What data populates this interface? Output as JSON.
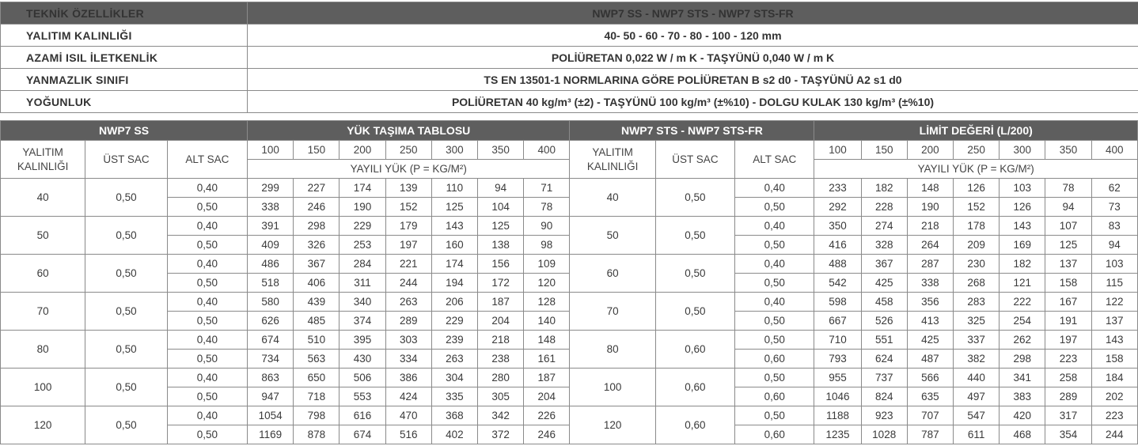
{
  "spec": {
    "header": [
      "TEKNİK ÖZELLİKLER",
      "NWP7 SS - NWP7 STS - NWP7 STS-FR"
    ],
    "rows": [
      {
        "label": "YALITIM KALINLIĞI",
        "value": "40- 50 - 60 - 70 - 80 - 100 - 120 mm"
      },
      {
        "label": "AZAMİ ISIL İLETKENLİK",
        "value": "POLİÜRETAN 0,022 W / m K - TAŞYÜNÜ 0,040 W / m K"
      },
      {
        "label": "YANMAZLIK SINIFI",
        "value": "TS EN 13501-1 NORMLARINA GÖRE POLİÜRETAN B s2 d0 - TAŞYÜNÜ A2 s1 d0"
      },
      {
        "label": "YOĞUNLUK",
        "value": "POLİÜRETAN 40 kg/m³ (±2) - TAŞYÜNÜ 100 kg/m³ (±%10) - DOLGU KULAK 130 kg/m³ (±%10)"
      }
    ]
  },
  "load": {
    "left_title": "NWP7 SS",
    "left_table_title": "YÜK TAŞIMA TABLOSU",
    "right_title": "NWP7 STS - NWP7 STS-FR",
    "right_table_title": "LİMİT DEĞERİ (L/200)",
    "col_thickness": "YALITIM KALINLIĞI",
    "col_top": "ÜST SAC",
    "col_bottom": "ALT SAC",
    "spans": [
      "100",
      "150",
      "200",
      "250",
      "300",
      "350",
      "400"
    ],
    "load_label": "YAYILI YÜK (P = KG/M²)",
    "left_groups": [
      {
        "thickness": "40",
        "top": "0,50",
        "rows": [
          {
            "bottom": "0,40",
            "values": [
              "299",
              "227",
              "174",
              "139",
              "110",
              "94",
              "71"
            ]
          },
          {
            "bottom": "0,50",
            "values": [
              "338",
              "246",
              "190",
              "152",
              "125",
              "104",
              "78"
            ]
          }
        ]
      },
      {
        "thickness": "50",
        "top": "0,50",
        "rows": [
          {
            "bottom": "0,40",
            "values": [
              "391",
              "298",
              "229",
              "179",
              "143",
              "125",
              "90"
            ]
          },
          {
            "bottom": "0,50",
            "values": [
              "409",
              "326",
              "253",
              "197",
              "160",
              "138",
              "98"
            ]
          }
        ]
      },
      {
        "thickness": "60",
        "top": "0,50",
        "rows": [
          {
            "bottom": "0,40",
            "values": [
              "486",
              "367",
              "284",
              "221",
              "174",
              "156",
              "109"
            ]
          },
          {
            "bottom": "0,50",
            "values": [
              "518",
              "406",
              "311",
              "244",
              "194",
              "172",
              "120"
            ]
          }
        ]
      },
      {
        "thickness": "70",
        "top": "0,50",
        "rows": [
          {
            "bottom": "0,40",
            "values": [
              "580",
              "439",
              "340",
              "263",
              "206",
              "187",
              "128"
            ]
          },
          {
            "bottom": "0,50",
            "values": [
              "626",
              "485",
              "374",
              "289",
              "229",
              "204",
              "140"
            ]
          }
        ]
      },
      {
        "thickness": "80",
        "top": "0,50",
        "rows": [
          {
            "bottom": "0,40",
            "values": [
              "674",
              "510",
              "395",
              "303",
              "239",
              "218",
              "148"
            ]
          },
          {
            "bottom": "0,50",
            "values": [
              "734",
              "563",
              "430",
              "334",
              "263",
              "238",
              "161"
            ]
          }
        ]
      },
      {
        "thickness": "100",
        "top": "0,50",
        "rows": [
          {
            "bottom": "0,40",
            "values": [
              "863",
              "650",
              "506",
              "386",
              "304",
              "280",
              "187"
            ]
          },
          {
            "bottom": "0,50",
            "values": [
              "947",
              "718",
              "553",
              "424",
              "335",
              "305",
              "204"
            ]
          }
        ]
      },
      {
        "thickness": "120",
        "top": "0,50",
        "rows": [
          {
            "bottom": "0,40",
            "values": [
              "1054",
              "798",
              "616",
              "470",
              "368",
              "342",
              "226"
            ]
          },
          {
            "bottom": "0,50",
            "values": [
              "1169",
              "878",
              "674",
              "516",
              "402",
              "372",
              "246"
            ]
          }
        ]
      }
    ],
    "right_groups": [
      {
        "thickness": "40",
        "top": "0,50",
        "rows": [
          {
            "bottom": "0,40",
            "values": [
              "233",
              "182",
              "148",
              "126",
              "103",
              "78",
              "62"
            ]
          },
          {
            "bottom": "0,50",
            "values": [
              "292",
              "228",
              "190",
              "152",
              "126",
              "94",
              "73"
            ]
          }
        ]
      },
      {
        "thickness": "50",
        "top": "0,50",
        "rows": [
          {
            "bottom": "0,40",
            "values": [
              "350",
              "274",
              "218",
              "178",
              "143",
              "107",
              "83"
            ]
          },
          {
            "bottom": "0,50",
            "values": [
              "416",
              "328",
              "264",
              "209",
              "169",
              "125",
              "94"
            ]
          }
        ]
      },
      {
        "thickness": "60",
        "top": "0,50",
        "rows": [
          {
            "bottom": "0,40",
            "values": [
              "488",
              "367",
              "287",
              "230",
              "182",
              "137",
              "103"
            ]
          },
          {
            "bottom": "0,50",
            "values": [
              "542",
              "425",
              "338",
              "268",
              "121",
              "158",
              "115"
            ]
          }
        ]
      },
      {
        "thickness": "70",
        "top": "0,50",
        "rows": [
          {
            "bottom": "0,40",
            "values": [
              "598",
              "458",
              "356",
              "283",
              "222",
              "167",
              "122"
            ]
          },
          {
            "bottom": "0,50",
            "values": [
              "667",
              "526",
              "413",
              "325",
              "254",
              "191",
              "137"
            ]
          }
        ]
      },
      {
        "thickness": "80",
        "top": "0,60",
        "rows": [
          {
            "bottom": "0,50",
            "values": [
              "710",
              "551",
              "425",
              "337",
              "262",
              "197",
              "143"
            ]
          },
          {
            "bottom": "0,60",
            "values": [
              "793",
              "624",
              "487",
              "382",
              "298",
              "223",
              "158"
            ]
          }
        ]
      },
      {
        "thickness": "100",
        "top": "0,60",
        "rows": [
          {
            "bottom": "0,50",
            "values": [
              "955",
              "737",
              "566",
              "440",
              "341",
              "258",
              "184"
            ]
          },
          {
            "bottom": "0,60",
            "values": [
              "1046",
              "824",
              "635",
              "497",
              "383",
              "289",
              "202"
            ]
          }
        ]
      },
      {
        "thickness": "120",
        "top": "0,60",
        "rows": [
          {
            "bottom": "0,50",
            "values": [
              "1188",
              "923",
              "707",
              "547",
              "420",
              "317",
              "223"
            ]
          },
          {
            "bottom": "0,60",
            "values": [
              "1235",
              "1028",
              "787",
              "611",
              "468",
              "354",
              "244"
            ]
          }
        ]
      }
    ]
  }
}
